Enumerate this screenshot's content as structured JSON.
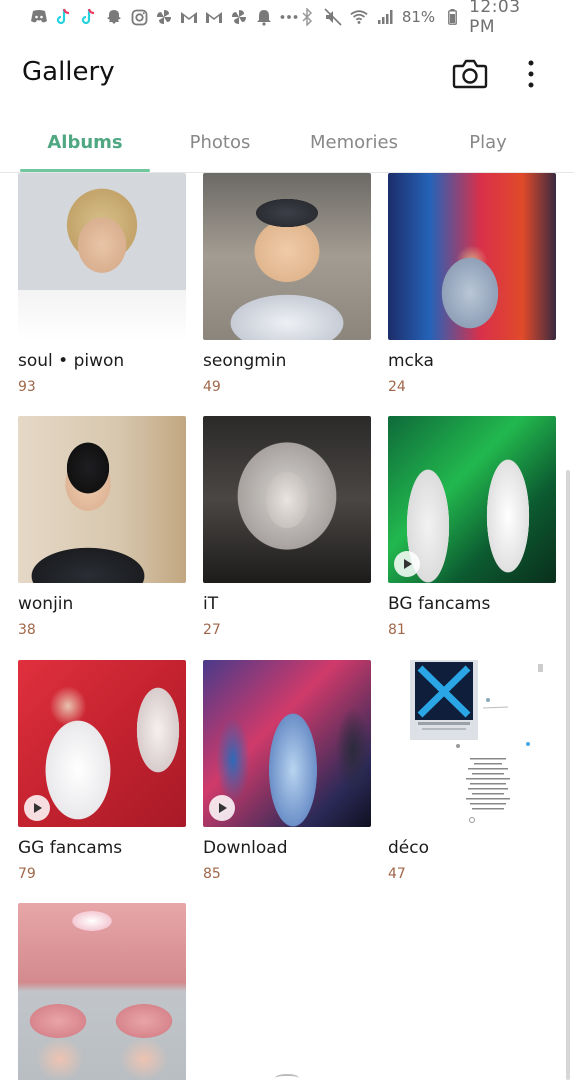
{
  "status_bar": {
    "battery": "81%",
    "time": "12:03 PM",
    "left_icons": [
      "discord-icon",
      "tiktok-icon",
      "tiktok-icon",
      "snapchat-icon",
      "instagram-icon",
      "pinwheel-icon",
      "gmail-icon",
      "gmail-icon",
      "pinwheel-icon",
      "bell-icon",
      "more-dots-icon"
    ],
    "right_icons": [
      "bluetooth-icon",
      "mute-icon",
      "wifi-icon",
      "signal-icon"
    ]
  },
  "header": {
    "title": "Gallery"
  },
  "tabs": [
    {
      "label": "Albums",
      "active": true
    },
    {
      "label": "Photos",
      "active": false
    },
    {
      "label": "Memories",
      "active": false
    },
    {
      "label": "Play",
      "active": false
    }
  ],
  "albums": [
    {
      "name": "soul • piwon",
      "count": "93",
      "video": false
    },
    {
      "name": "seongmin",
      "count": "49",
      "video": false
    },
    {
      "name": "mcka",
      "count": "24",
      "video": false
    },
    {
      "name": "wonjin",
      "count": "38",
      "video": false
    },
    {
      "name": "iT",
      "count": "27",
      "video": false
    },
    {
      "name": "BG fancams",
      "count": "81",
      "video": true
    },
    {
      "name": "GG fancams",
      "count": "79",
      "video": true
    },
    {
      "name": "Download",
      "count": "85",
      "video": true
    },
    {
      "name": "déco",
      "count": "47",
      "video": false
    },
    {
      "name": "",
      "count": "",
      "video": false
    }
  ],
  "colors": {
    "accent": "#4fa882",
    "count": "#a0674a"
  }
}
